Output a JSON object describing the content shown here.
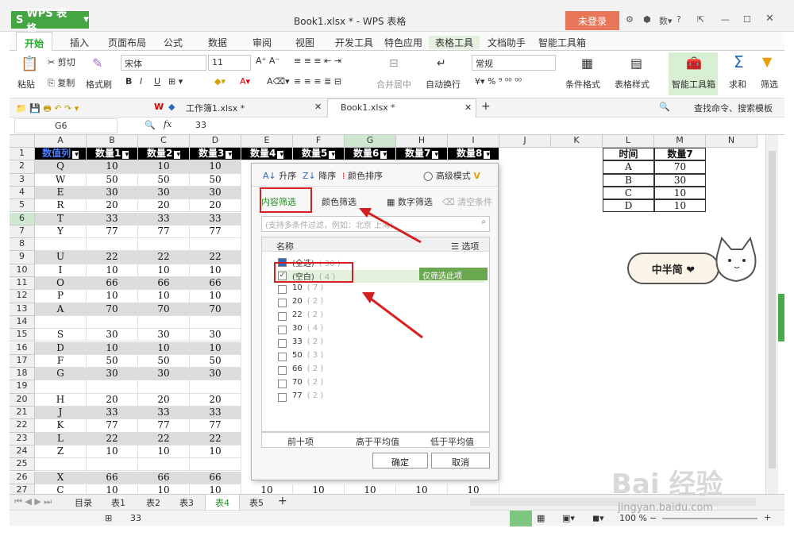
{
  "titlebar": {
    "app_label": "WPS 表格",
    "document_title": "Book1.xlsx * - WPS 表格",
    "login_label": "未登录"
  },
  "ribbon_tabs": [
    "开始",
    "插入",
    "页面布局",
    "公式",
    "数据",
    "审阅",
    "视图",
    "开发工具",
    "特色应用",
    "表格工具",
    "文档助手",
    "智能工具箱"
  ],
  "ribbon": {
    "paste": "粘贴",
    "cut": "剪切",
    "copy": "复制",
    "format_painter": "格式刷",
    "font_name": "宋体",
    "font_size": "11",
    "merge": "合并居中",
    "wrap": "自动换行",
    "number_format": "常规",
    "cond_format": "条件格式",
    "table_style": "表格样式",
    "smart_toolbox": "智能工具箱",
    "sum": "求和",
    "filter": "筛选"
  },
  "doc_tabs": [
    "工作簿1.xlsx *",
    "Book1.xlsx *"
  ],
  "search_label": "查找命令、搜索模板",
  "formula": {
    "name_box": "G6",
    "fx": "fx",
    "value": "33"
  },
  "columns": [
    "A",
    "B",
    "C",
    "D",
    "E",
    "F",
    "G",
    "H",
    "I",
    "J",
    "K",
    "L",
    "M",
    "N"
  ],
  "headers": [
    "数值列",
    "数量1",
    "数量2",
    "数量3",
    "数量4",
    "数量5",
    "数量6",
    "数量7",
    "数量8"
  ],
  "rows": [
    {
      "n": "2",
      "a": "Q",
      "b": "10",
      "c": "10",
      "d": "10",
      "gray": true
    },
    {
      "n": "3",
      "a": "W",
      "b": "50",
      "c": "50",
      "d": "50",
      "gray": false
    },
    {
      "n": "4",
      "a": "E",
      "b": "30",
      "c": "30",
      "d": "30",
      "gray": true
    },
    {
      "n": "5",
      "a": "R",
      "b": "20",
      "c": "20",
      "d": "20",
      "gray": false
    },
    {
      "n": "6",
      "a": "T",
      "b": "33",
      "c": "33",
      "d": "33",
      "gray": true
    },
    {
      "n": "7",
      "a": "Y",
      "b": "77",
      "c": "77",
      "d": "77",
      "gray": false
    },
    {
      "n": "8",
      "a": "",
      "b": "",
      "c": "",
      "d": "",
      "gray": false
    },
    {
      "n": "9",
      "a": "U",
      "b": "22",
      "c": "22",
      "d": "22",
      "gray": true
    },
    {
      "n": "10",
      "a": "I",
      "b": "10",
      "c": "10",
      "d": "10",
      "gray": false
    },
    {
      "n": "11",
      "a": "O",
      "b": "66",
      "c": "66",
      "d": "66",
      "gray": true
    },
    {
      "n": "12",
      "a": "P",
      "b": "10",
      "c": "10",
      "d": "10",
      "gray": false
    },
    {
      "n": "13",
      "a": "A",
      "b": "70",
      "c": "70",
      "d": "70",
      "gray": true
    },
    {
      "n": "14",
      "a": "",
      "b": "",
      "c": "",
      "d": "",
      "gray": false
    },
    {
      "n": "15",
      "a": "S",
      "b": "30",
      "c": "30",
      "d": "30",
      "gray": false
    },
    {
      "n": "16",
      "a": "D",
      "b": "10",
      "c": "10",
      "d": "10",
      "gray": true
    },
    {
      "n": "17",
      "a": "F",
      "b": "50",
      "c": "50",
      "d": "50",
      "gray": false
    },
    {
      "n": "18",
      "a": "G",
      "b": "30",
      "c": "30",
      "d": "30",
      "gray": true
    },
    {
      "n": "19",
      "a": "",
      "b": "",
      "c": "",
      "d": "",
      "gray": false
    },
    {
      "n": "20",
      "a": "H",
      "b": "20",
      "c": "20",
      "d": "20",
      "gray": false
    },
    {
      "n": "21",
      "a": "J",
      "b": "33",
      "c": "33",
      "d": "33",
      "gray": true
    },
    {
      "n": "22",
      "a": "K",
      "b": "77",
      "c": "77",
      "d": "77",
      "gray": false
    },
    {
      "n": "23",
      "a": "L",
      "b": "22",
      "c": "22",
      "d": "22",
      "gray": true
    },
    {
      "n": "24",
      "a": "Z",
      "b": "10",
      "c": "10",
      "d": "10",
      "gray": false
    },
    {
      "n": "25",
      "a": "",
      "b": "",
      "c": "",
      "d": "",
      "gray": false
    },
    {
      "n": "26",
      "a": "X",
      "b": "66",
      "c": "66",
      "d": "66",
      "gray": true
    },
    {
      "n": "27",
      "a": "C",
      "b": "10",
      "c": "10",
      "d": "10",
      "gray": false
    }
  ],
  "row27_tail": [
    "10",
    "10",
    "10",
    "10",
    "10"
  ],
  "side_table": {
    "headers": [
      "时间",
      "数量7"
    ],
    "rows": [
      [
        "A",
        "70"
      ],
      [
        "B",
        "30"
      ],
      [
        "C",
        "10"
      ],
      [
        "D",
        "10"
      ]
    ]
  },
  "filter_popup": {
    "sort_asc": "升序",
    "sort_desc": "降序",
    "color_sort": "颜色排序",
    "advanced": "高级模式",
    "tab_content": "内容筛选",
    "tab_color": "颜色筛选",
    "number_filter": "数字筛选",
    "clear_filter": "清空条件",
    "search_placeholder": "(支持多条件过滤，例如：北京 上海)",
    "list_title": "名称",
    "options": "选项",
    "only_this": "仅筛选此项",
    "items": [
      {
        "label": "(全选)",
        "count": "( 30 )",
        "checked": "partial"
      },
      {
        "label": "(空白)",
        "count": "( 4 )",
        "checked": "yes"
      },
      {
        "label": "10",
        "count": "( 7 )",
        "checked": "no"
      },
      {
        "label": "20",
        "count": "( 2 )",
        "checked": "no"
      },
      {
        "label": "22",
        "count": "( 2 )",
        "checked": "no"
      },
      {
        "label": "30",
        "count": "( 4 )",
        "checked": "no"
      },
      {
        "label": "33",
        "count": "( 2 )",
        "checked": "no"
      },
      {
        "label": "50",
        "count": "( 3 )",
        "checked": "no"
      },
      {
        "label": "66",
        "count": "( 2 )",
        "checked": "no"
      },
      {
        "label": "70",
        "count": "( 2 )",
        "checked": "no"
      },
      {
        "label": "77",
        "count": "( 2 )",
        "checked": "no"
      }
    ],
    "top10": "前十项",
    "above_avg": "高于平均值",
    "below_avg": "低于平均值",
    "ok": "确定",
    "cancel": "取消"
  },
  "sheet_tabs": [
    "目录",
    "表1",
    "表2",
    "表3",
    "表4",
    "表5"
  ],
  "active_sheet": "表4",
  "status": {
    "sum": "33",
    "zoom": "100 %"
  },
  "sticker_text": "中半简 ❤",
  "watermark": {
    "brand": "Bai 经验",
    "url": "jingyan.baidu.com"
  },
  "colors": {
    "accent_green": "#44a543",
    "header_black": "#000000",
    "red_annotation": "#d42020",
    "login_bg": "#e8775a"
  }
}
